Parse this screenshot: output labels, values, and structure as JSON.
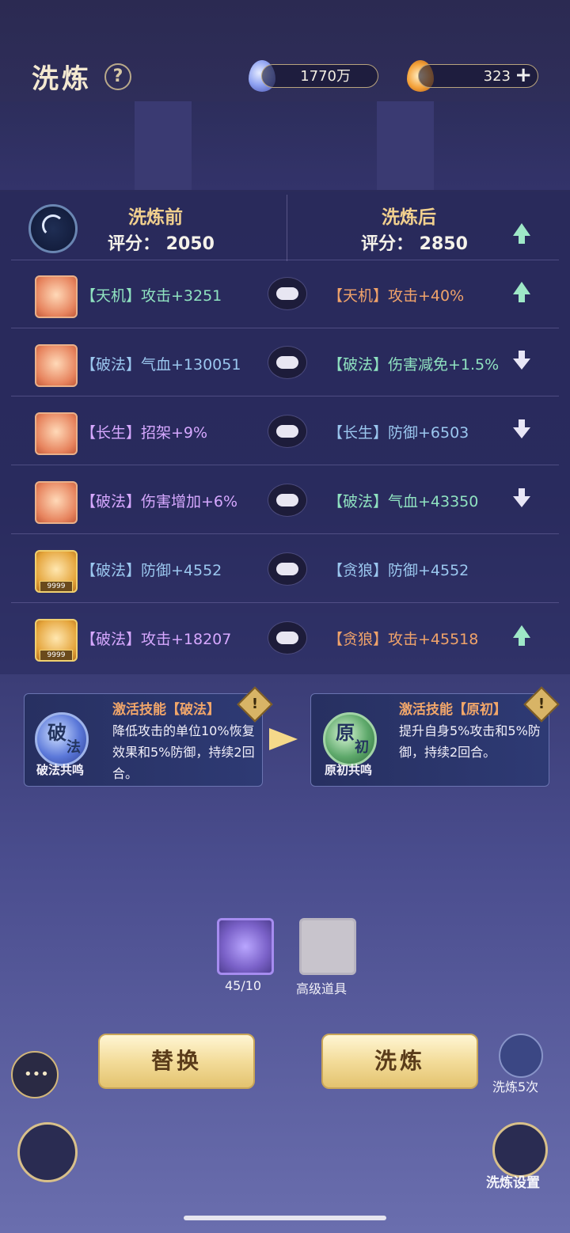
{
  "header": {
    "title": "洗炼",
    "help_icon": "question-icon",
    "currency1": {
      "icon": "spirit-gem-icon",
      "value": "1770万"
    },
    "currency2": {
      "icon": "flame-gem-icon",
      "value": "323"
    }
  },
  "compare": {
    "before_label": "洗炼前",
    "before_score": "评分：  2050",
    "after_label": "洗炼后",
    "after_score": "评分：  2850"
  },
  "rows": [
    {
      "before": "【天机】攻击+3251",
      "after": "【天机】攻击+40%",
      "trend": "up"
    },
    {
      "before": "【破法】气血+130051",
      "after": "【破法】伤害减免+1.5%",
      "trend": "down"
    },
    {
      "before": "【长生】招架+9%",
      "after": "【长生】防御+6503",
      "trend": "down"
    },
    {
      "before": "【破法】伤害增加+6%",
      "after": "【破法】气血+43350",
      "trend": "down"
    },
    {
      "before": "【破法】防御+4552",
      "after": "【贪狼】防御+4552",
      "trend": "none"
    },
    {
      "before": "【破法】攻击+18207",
      "after": "【贪狼】攻击+45518",
      "trend": "up"
    }
  ],
  "badge": "9999",
  "skills": {
    "left": {
      "title": "激活技能【破法】",
      "orb_main": "破",
      "orb_sub": "法",
      "orb_label": "破法共鸣",
      "desc": "降低攻击的单位10%恢复效果和5%防御，持续2回合。"
    },
    "right": {
      "title": "激活技能【原初】",
      "orb_main": "原",
      "orb_sub": "初",
      "orb_label": "原初共鸣",
      "desc": "提升自身5%攻击和5%防御，持续2回合。"
    }
  },
  "materials": [
    {
      "name": "crystal",
      "label": "45/10"
    },
    {
      "name": "advanced-item",
      "label": "高级道具"
    }
  ],
  "buttons": {
    "replace": "替换",
    "refine": "洗炼",
    "refine5": "洗炼5次",
    "settings": "洗炼设置"
  }
}
